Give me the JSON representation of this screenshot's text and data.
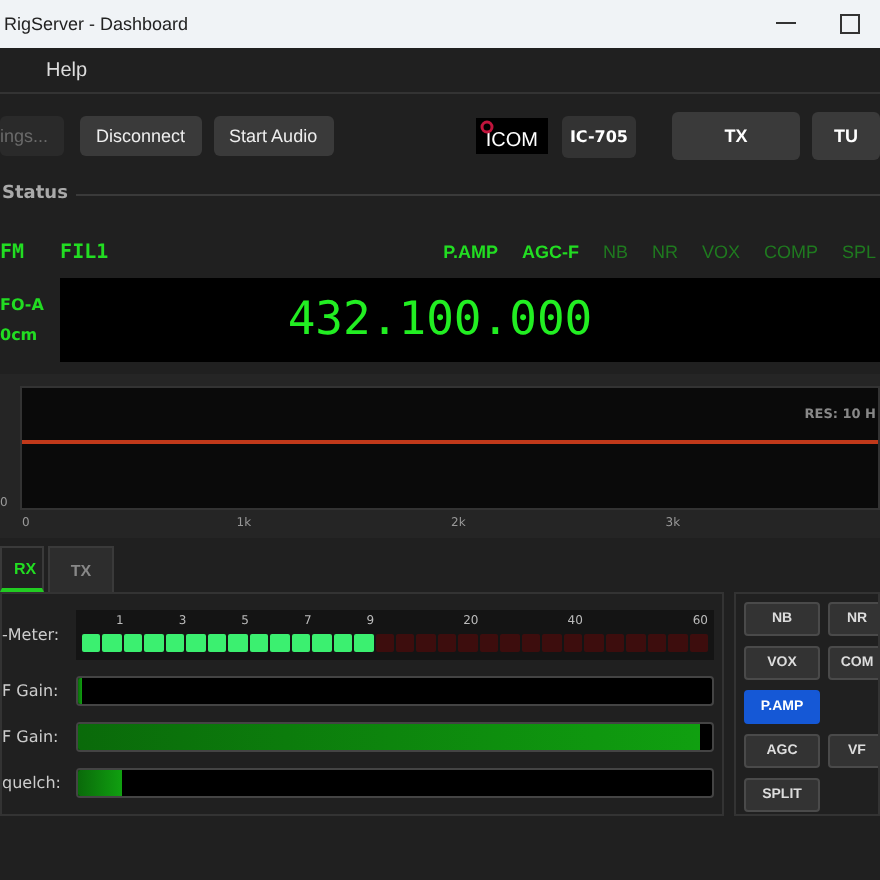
{
  "window": {
    "title": "RigServer - Dashboard"
  },
  "menu": [
    "Help"
  ],
  "toolbar": {
    "buttons": [
      {
        "label": "ings...",
        "disabled": true
      },
      {
        "label": "Disconnect",
        "disabled": false
      },
      {
        "label": "Start Audio",
        "disabled": false
      }
    ],
    "logo": "ICOM",
    "model": "IC-705",
    "actions": [
      "TX",
      "TU"
    ]
  },
  "status": {
    "title": "Status",
    "modes": [
      "FM",
      "FIL1"
    ],
    "indicators": [
      {
        "label": "P.AMP",
        "on": true
      },
      {
        "label": "AGC-F",
        "on": true
      },
      {
        "label": "NB",
        "on": false
      },
      {
        "label": "NR",
        "on": false
      },
      {
        "label": "VOX",
        "on": false
      },
      {
        "label": "COMP",
        "on": false
      },
      {
        "label": "SPL",
        "on": false
      }
    ],
    "vfo": "FO-A",
    "band": "0cm",
    "frequency": "432.100.000"
  },
  "spectrum": {
    "res": "RES: 10 H",
    "y_tick": "0",
    "x_ticks": [
      "0",
      "1k",
      "2k",
      "3k"
    ]
  },
  "tabs": [
    {
      "label": "RX",
      "selected": true
    },
    {
      "label": "TX",
      "selected": false
    }
  ],
  "s_meter": {
    "label": "-Meter:",
    "scale": [
      "1",
      "3",
      "5",
      "7",
      "9",
      "20",
      "40",
      "60"
    ],
    "level": 0.467
  },
  "sliders": [
    {
      "label": "F Gain:",
      "level": 0.005
    },
    {
      "label": "F Gain:",
      "level": 0.98
    },
    {
      "label": "quelch:",
      "level": 0.07
    }
  ],
  "function_buttons": [
    {
      "label": "NB",
      "selected": false
    },
    {
      "label": "NR",
      "selected": false
    },
    {
      "label": "VOX",
      "selected": false
    },
    {
      "label": "COM",
      "selected": false
    },
    {
      "label": "P.AMP",
      "selected": true
    },
    {
      "label": "AGC",
      "selected": false
    },
    {
      "label": "VF",
      "selected": false
    },
    {
      "label": "SPLIT",
      "selected": false
    }
  ]
}
